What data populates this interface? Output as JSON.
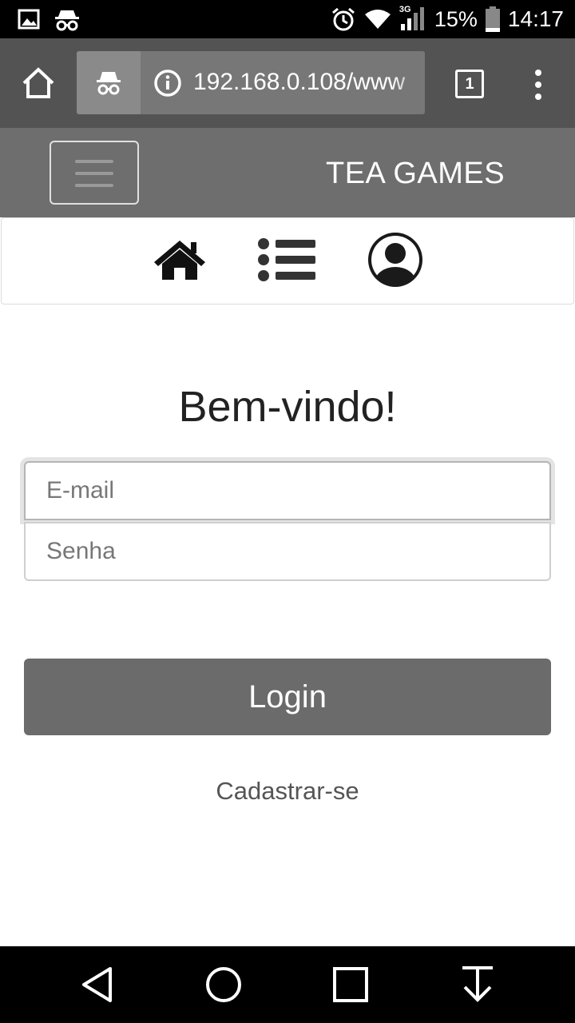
{
  "status_bar": {
    "battery_percent": "15%",
    "time": "14:17",
    "network": "3G",
    "icons": [
      "gallery-icon",
      "incognito-icon",
      "alarm-icon",
      "wifi-icon",
      "signal-icon",
      "battery-icon"
    ]
  },
  "browser": {
    "url": "192.168.0.108/www",
    "tab_count": "1",
    "icons": [
      "home-icon",
      "incognito-icon",
      "info-icon",
      "more-vert-icon"
    ]
  },
  "navbar": {
    "brand": "TEA GAMES",
    "toggler_icon": "hamburger-icon"
  },
  "icon_nav": {
    "items": [
      "home-icon",
      "list-icon",
      "user-circle-icon"
    ]
  },
  "login": {
    "title": "Bem-vindo!",
    "email_placeholder": "E-mail",
    "password_placeholder": "Senha",
    "submit_label": "Login",
    "signup_link": "Cadastrar-se"
  },
  "android_nav": {
    "icons": [
      "back-icon",
      "home-circle-icon",
      "recents-icon",
      "download-icon"
    ]
  },
  "colors": {
    "browser_bar": "#535353",
    "navbar": "#6e6e6e",
    "button": "#6b6b6b"
  }
}
